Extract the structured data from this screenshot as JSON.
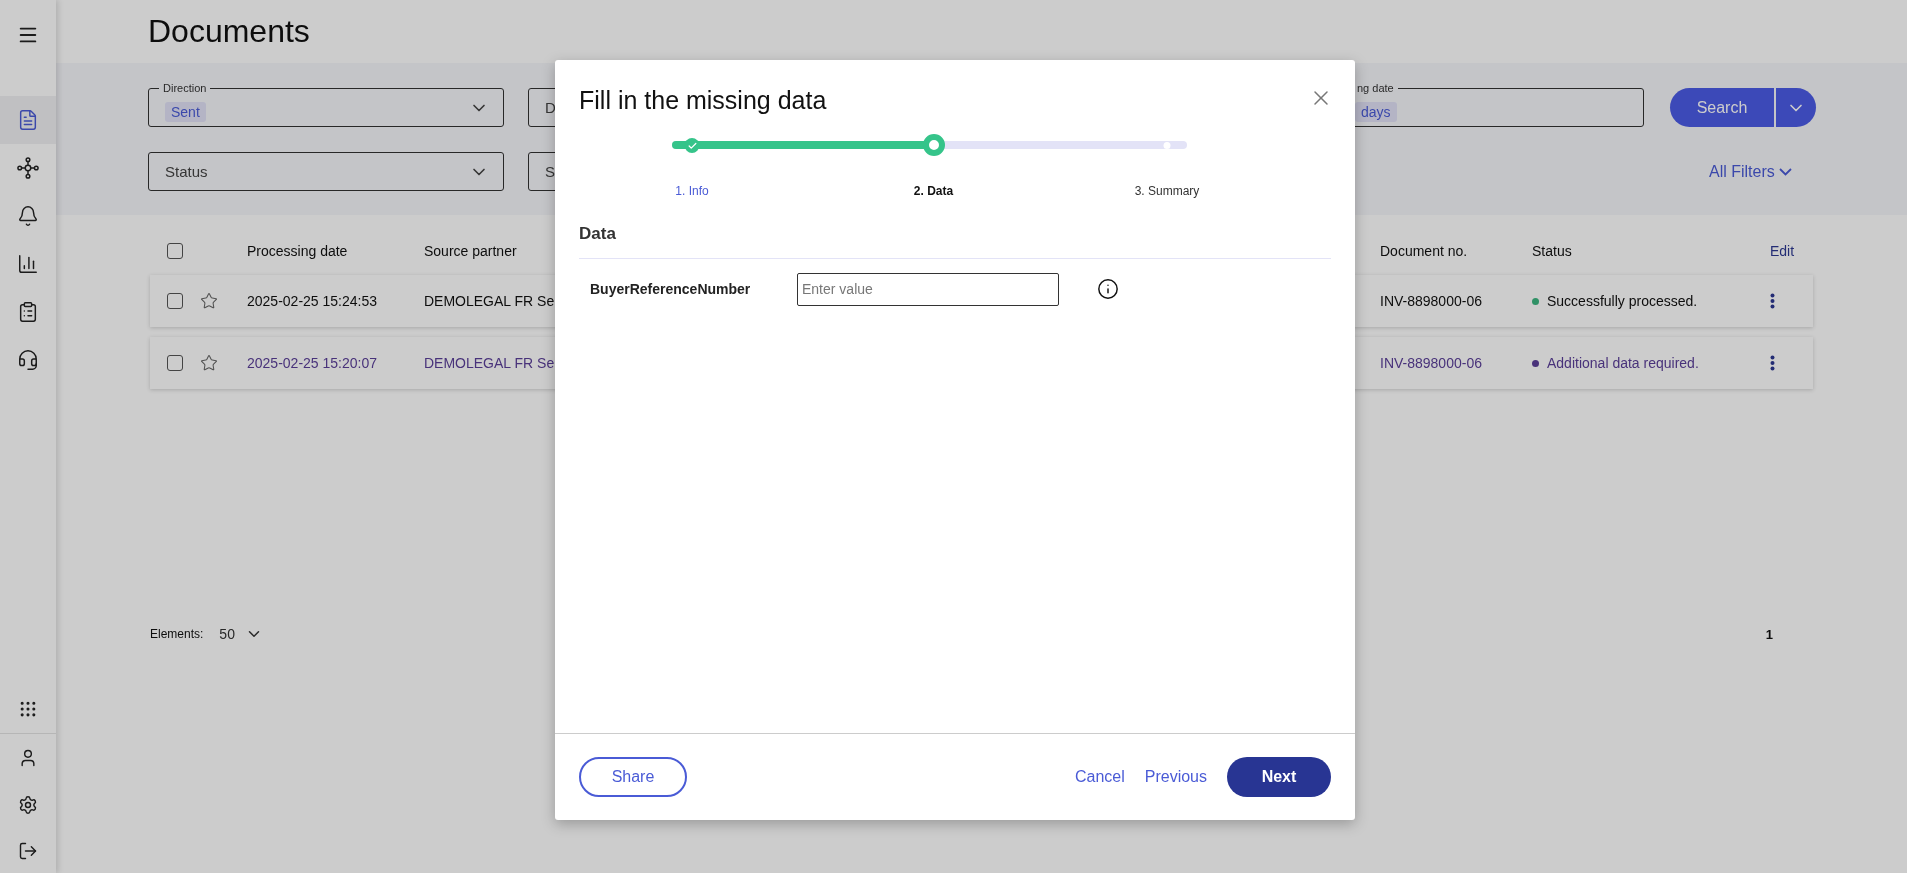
{
  "sidebar": {
    "items": [
      {
        "selected": true
      },
      {
        "selected": false
      },
      {
        "selected": false
      },
      {
        "selected": false
      },
      {
        "selected": false
      },
      {
        "selected": false
      }
    ],
    "bottom_items": [
      {
        "selected": false
      },
      {
        "selected": false
      },
      {
        "selected": false
      },
      {
        "selected": false
      }
    ]
  },
  "page": {
    "title": "Documents"
  },
  "filters": {
    "direction": {
      "label": "Direction",
      "chip": "Sent"
    },
    "second": {
      "placeholder": "D"
    },
    "date": {
      "label": "ng date",
      "chip": "days"
    },
    "status": {
      "placeholder": "Status"
    },
    "second_row2": {
      "placeholder": "S"
    },
    "search_button": "Search",
    "all_filters": "All Filters"
  },
  "table": {
    "all_checked": false,
    "columns": [
      "Processing date",
      "Source partner",
      "Document no.",
      "Status"
    ],
    "edit": "Edit",
    "rows": [
      {
        "checked": false,
        "starred": false,
        "attention": false,
        "date": "2025-02-25 15:24:53",
        "source": "DEMOLEGAL FR Se",
        "document_no": "INV-8898000-06",
        "status": "Successfully processed.",
        "color": "#309166"
      },
      {
        "checked": false,
        "starred": false,
        "attention": true,
        "date": "2025-02-25 15:20:07",
        "source": "DEMOLEGAL FR Se",
        "document_no": "INV-8898000-06",
        "status": "Additional data required.",
        "color": "#49327a"
      }
    ]
  },
  "footer": {
    "elements_label": "Elements:",
    "page_size": "50",
    "page": "1"
  },
  "dialog": {
    "title": "Fill in the missing data",
    "stepper": {
      "level": 0.5,
      "steps": [
        {
          "label": "1. Info",
          "done": true,
          "selected": false
        },
        {
          "label": "2. Data",
          "done": false,
          "selected": true
        },
        {
          "label": "3. Summary",
          "done": false,
          "selected": false
        }
      ]
    },
    "section": "Data",
    "fields": [
      {
        "label": "BuyerReferenceNumber",
        "placeholder": "Enter value"
      }
    ],
    "buttons": {
      "share": "Share",
      "cancel": "Cancel",
      "previous": "Previous",
      "next": "Next"
    }
  }
}
